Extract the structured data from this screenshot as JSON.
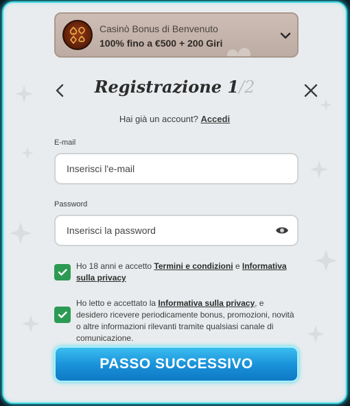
{
  "bonus": {
    "title": "Casinò Bonus di Benvenuto",
    "offer": "100% fino a €500 + 200 Giri"
  },
  "header": {
    "title": "Registrazione",
    "step_current": "1",
    "step_total": "/2"
  },
  "account_prompt": {
    "text": "Hai già un account? ",
    "link": "Accedi"
  },
  "form": {
    "email_label": "E-mail",
    "email_placeholder": "Inserisci l'e-mail",
    "password_label": "Password",
    "password_placeholder": "Inserisci la password"
  },
  "consents": [
    {
      "checked": true,
      "prefix": "Ho 18 anni e accetto ",
      "link1": "Termini e condizioni",
      "middle": " e ",
      "link2": "Informativa sulla privacy"
    },
    {
      "checked": true,
      "prefix": "Ho letto e accettato la ",
      "link1": "Informativa sulla privacy",
      "suffix": ", e desidero ricevere periodicamente bonus, promozioni, novità o altre informazioni rilevanti tramite qualsiasi canale di comunicazione."
    }
  ],
  "next_button": "PASSO SUCCESSIVO",
  "colors": {
    "accent_glow": "#3fd6e0",
    "checkbox": "#2c9a54",
    "button": "#1890d8"
  },
  "icons": [
    "card-suits-icon",
    "chevron-down-icon",
    "chevron-left-icon",
    "close-icon",
    "eye-icon",
    "check-icon"
  ]
}
